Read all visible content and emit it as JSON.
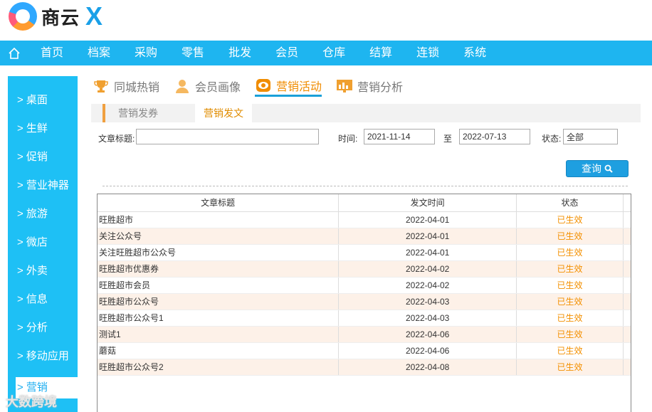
{
  "brand": {
    "name": "商云",
    "mark": "X"
  },
  "nav": {
    "items": [
      "首页",
      "档案",
      "采购",
      "零售",
      "批发",
      "会员",
      "仓库",
      "结算",
      "连锁",
      "系统"
    ]
  },
  "sidebar": {
    "items": [
      "> 桌面",
      "> 生鲜",
      "> 促销",
      "> 营业神器",
      "> 旅游",
      "> 微店",
      "> 外卖",
      "> 信息",
      "> 分析",
      "> 移动应用",
      "> 营销"
    ]
  },
  "tabs": [
    "同城热销",
    "会员画像",
    "营销活动",
    "营销分析"
  ],
  "subtabs": [
    "营销发券",
    "营销发文"
  ],
  "filters": {
    "title_label": "文章标题:",
    "title_value": "",
    "time_label": "时间:",
    "date_from": "2021-11-14",
    "to_label": "至",
    "date_to": "2022-07-13",
    "status_label": "状态:",
    "status_value": "全部"
  },
  "query_button": "查询",
  "table": {
    "headers": [
      "文章标题",
      "发文时间",
      "状态"
    ],
    "rows": [
      [
        "旺胜超市",
        "2022-04-01",
        "已生效"
      ],
      [
        "关注公众号",
        "2022-04-01",
        "已生效"
      ],
      [
        "关注旺胜超市公众号",
        "2022-04-01",
        "已生效"
      ],
      [
        "旺胜超市优惠券",
        "2022-04-02",
        "已生效"
      ],
      [
        "旺胜超市会员",
        "2022-04-02",
        "已生效"
      ],
      [
        "旺胜超市公众号",
        "2022-04-03",
        "已生效"
      ],
      [
        "旺胜超市公众号1",
        "2022-04-03",
        "已生效"
      ],
      [
        "测试1",
        "2022-04-06",
        "已生效"
      ],
      [
        "蘑菇",
        "2022-04-06",
        "已生效"
      ],
      [
        "旺胜超市公众号2",
        "2022-04-08",
        "已生效"
      ]
    ]
  },
  "watermark": "大数跨境",
  "colors": {
    "nav": "#1eb5f0",
    "sidebar": "#1ec0f5",
    "accent": "#f08c00",
    "button": "#1e9fe0"
  }
}
